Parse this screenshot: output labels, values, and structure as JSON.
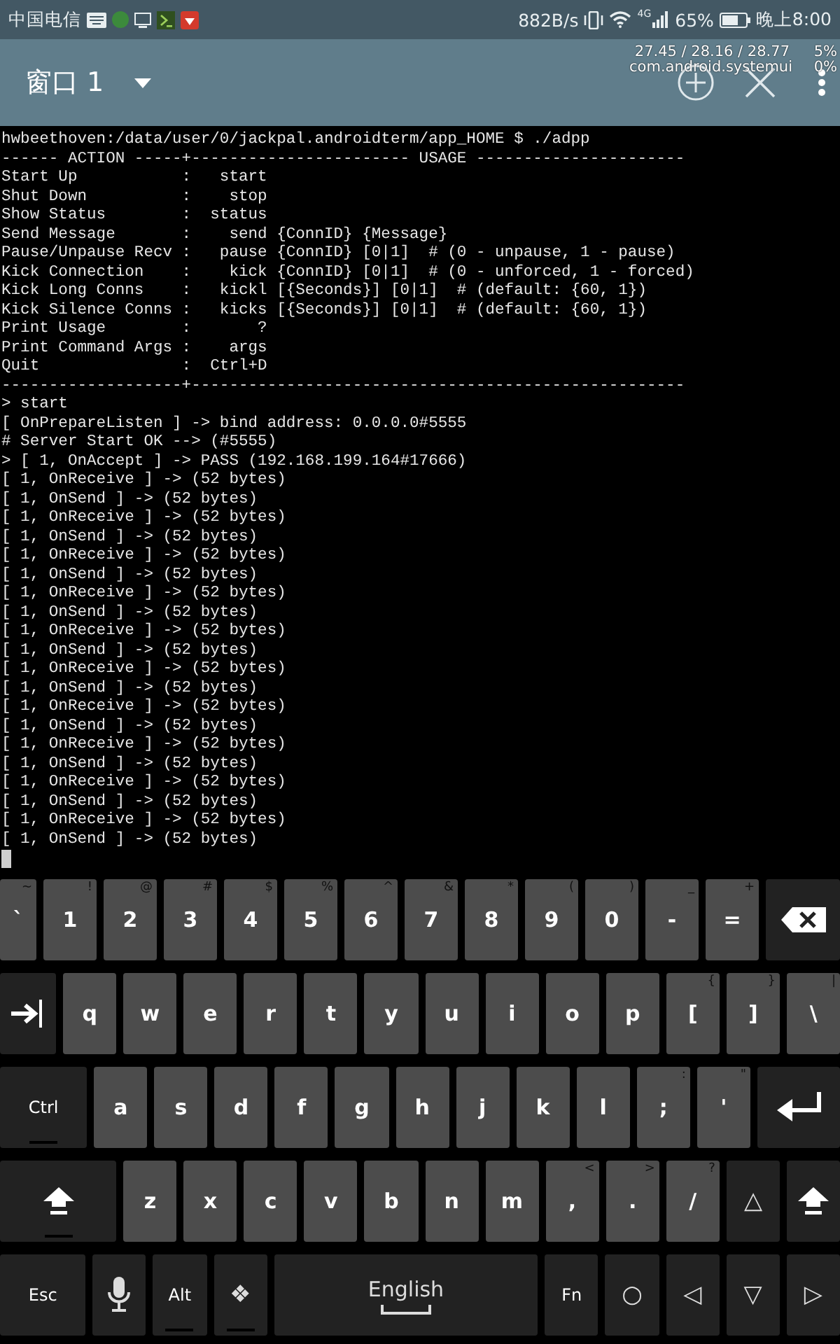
{
  "status_bar": {
    "carrier": "中国电信",
    "speed": "882B/s",
    "network": "4G",
    "battery": "65%",
    "time": "晚上8:00"
  },
  "app_bar": {
    "title": "窗口 1"
  },
  "overlay": {
    "load": "27.45 / 28.16 / 28.77",
    "cpu": "5%",
    "process": "com.android.systemui",
    "process_cpu": "0%"
  },
  "terminal": {
    "lines": [
      "hwbeethoven:/data/user/0/jackpal.androidterm/app_HOME $ ./adpp",
      "------ ACTION -----+----------------------- USAGE ----------------------",
      "Start Up           :   start",
      "Shut Down          :    stop",
      "Show Status        :  status",
      "Send Message       :    send {ConnID} {Message}",
      "Pause/Unpause Recv :   pause {ConnID} [0|1]  # (0 - unpause, 1 - pause)",
      "Kick Connection    :    kick {ConnID} [0|1]  # (0 - unforced, 1 - forced)",
      "Kick Long Conns    :   kickl [{Seconds}] [0|1]  # (default: {60, 1})",
      "Kick Silence Conns :   kicks [{Seconds}] [0|1]  # (default: {60, 1})",
      "Print Usage        :       ?",
      "Print Command Args :    args",
      "Quit               :  Ctrl+D",
      "-------------------+----------------------------------------------------",
      "> start",
      "[ OnPrepareListen ] -> bind address: 0.0.0.0#5555",
      "# Server Start OK --> (#5555)",
      "> [ 1, OnAccept ] -> PASS (192.168.199.164#17666)",
      "[ 1, OnReceive ] -> (52 bytes)",
      "[ 1, OnSend ] -> (52 bytes)",
      "[ 1, OnReceive ] -> (52 bytes)",
      "[ 1, OnSend ] -> (52 bytes)",
      "[ 1, OnReceive ] -> (52 bytes)",
      "[ 1, OnSend ] -> (52 bytes)",
      "[ 1, OnReceive ] -> (52 bytes)",
      "[ 1, OnSend ] -> (52 bytes)",
      "[ 1, OnReceive ] -> (52 bytes)",
      "[ 1, OnSend ] -> (52 bytes)",
      "[ 1, OnReceive ] -> (52 bytes)",
      "[ 1, OnSend ] -> (52 bytes)",
      "[ 1, OnReceive ] -> (52 bytes)",
      "[ 1, OnSend ] -> (52 bytes)",
      "[ 1, OnReceive ] -> (52 bytes)",
      "[ 1, OnSend ] -> (52 bytes)",
      "[ 1, OnReceive ] -> (52 bytes)",
      "[ 1, OnSend ] -> (52 bytes)",
      "[ 1, OnReceive ] -> (52 bytes)",
      "[ 1, OnSend ] -> (52 bytes)"
    ]
  },
  "keyboard": {
    "rows": [
      {
        "keys": [
          {
            "label": "`",
            "hint": "~",
            "kind": "char",
            "indicator": false
          },
          {
            "label": "1",
            "hint": "!",
            "kind": "char",
            "indicator": false
          },
          {
            "label": "2",
            "hint": "@",
            "kind": "char",
            "indicator": false
          },
          {
            "label": "3",
            "hint": "#",
            "kind": "char",
            "indicator": false
          },
          {
            "label": "4",
            "hint": "$",
            "kind": "char",
            "indicator": false
          },
          {
            "label": "5",
            "hint": "%",
            "kind": "char",
            "indicator": false
          },
          {
            "label": "6",
            "hint": "^",
            "kind": "char",
            "indicator": false
          },
          {
            "label": "7",
            "hint": "&",
            "kind": "char",
            "indicator": false
          },
          {
            "label": "8",
            "hint": "*",
            "kind": "char",
            "indicator": false
          },
          {
            "label": "9",
            "hint": "(",
            "kind": "char",
            "indicator": false
          },
          {
            "label": "0",
            "hint": ")",
            "kind": "char",
            "indicator": false
          },
          {
            "label": "-",
            "hint": "_",
            "kind": "char",
            "indicator": false
          },
          {
            "label": "=",
            "hint": "+",
            "kind": "char",
            "indicator": false
          },
          {
            "kind": "backspace",
            "indicator": false
          }
        ]
      },
      {
        "keys": [
          {
            "kind": "tab",
            "indicator": false
          },
          {
            "label": "q",
            "kind": "char",
            "indicator": false
          },
          {
            "label": "w",
            "kind": "char",
            "indicator": false
          },
          {
            "label": "e",
            "kind": "char",
            "indicator": false
          },
          {
            "label": "r",
            "kind": "char",
            "indicator": false
          },
          {
            "label": "t",
            "kind": "char",
            "indicator": false
          },
          {
            "label": "y",
            "kind": "char",
            "indicator": false
          },
          {
            "label": "u",
            "kind": "char",
            "indicator": false
          },
          {
            "label": "i",
            "kind": "char",
            "indicator": false
          },
          {
            "label": "o",
            "kind": "char",
            "indicator": false
          },
          {
            "label": "p",
            "kind": "char",
            "indicator": false
          },
          {
            "label": "[",
            "hint": "{",
            "kind": "char",
            "indicator": false
          },
          {
            "label": "]",
            "hint": "}",
            "kind": "char",
            "indicator": false
          },
          {
            "label": "\\",
            "hint": "|",
            "kind": "char",
            "indicator": false
          }
        ]
      },
      {
        "keys": [
          {
            "label": "Ctrl",
            "kind": "fn",
            "indicator": true
          },
          {
            "label": "a",
            "kind": "char",
            "indicator": false
          },
          {
            "label": "s",
            "kind": "char",
            "indicator": false
          },
          {
            "label": "d",
            "kind": "char",
            "indicator": false
          },
          {
            "label": "f",
            "kind": "char",
            "indicator": false
          },
          {
            "label": "g",
            "kind": "char",
            "indicator": false
          },
          {
            "label": "h",
            "kind": "char",
            "indicator": false
          },
          {
            "label": "j",
            "kind": "char",
            "indicator": false
          },
          {
            "label": "k",
            "kind": "char",
            "indicator": false
          },
          {
            "label": "l",
            "kind": "char",
            "indicator": false
          },
          {
            "label": ";",
            "hint": ":",
            "kind": "char",
            "indicator": false
          },
          {
            "label": "'",
            "hint": "\"",
            "kind": "char",
            "indicator": false
          },
          {
            "kind": "enter",
            "indicator": false
          }
        ]
      },
      {
        "keys": [
          {
            "kind": "shift",
            "indicator": true
          },
          {
            "label": "z",
            "kind": "char",
            "indicator": false
          },
          {
            "label": "x",
            "kind": "char",
            "indicator": false
          },
          {
            "label": "c",
            "kind": "char",
            "indicator": false
          },
          {
            "label": "v",
            "kind": "char",
            "indicator": false
          },
          {
            "label": "b",
            "kind": "char",
            "indicator": false
          },
          {
            "label": "n",
            "kind": "char",
            "indicator": false
          },
          {
            "label": "m",
            "kind": "char",
            "indicator": false
          },
          {
            "label": ",",
            "hint": "<",
            "kind": "char",
            "indicator": false
          },
          {
            "label": ".",
            "hint": ">",
            "kind": "char",
            "indicator": false
          },
          {
            "label": "/",
            "hint": "?",
            "kind": "char",
            "indicator": false
          },
          {
            "label": "△",
            "kind": "fn",
            "indicator": false
          },
          {
            "kind": "shift",
            "indicator": false
          }
        ]
      },
      {
        "keys": [
          {
            "label": "Esc",
            "kind": "fn",
            "indicator": false
          },
          {
            "kind": "mic",
            "indicator": false
          },
          {
            "label": "Alt",
            "kind": "fn",
            "indicator": true
          },
          {
            "label": "❖",
            "kind": "fn",
            "indicator": true
          },
          {
            "label": "English",
            "kind": "space",
            "indicator": false
          },
          {
            "label": "Fn",
            "kind": "fn",
            "indicator": false
          },
          {
            "label": "○",
            "kind": "fn",
            "indicator": false
          },
          {
            "label": "◁",
            "kind": "fn",
            "indicator": false
          },
          {
            "label": "▽",
            "kind": "fn",
            "indicator": false
          },
          {
            "label": "▷",
            "kind": "fn",
            "indicator": false
          }
        ]
      }
    ]
  }
}
